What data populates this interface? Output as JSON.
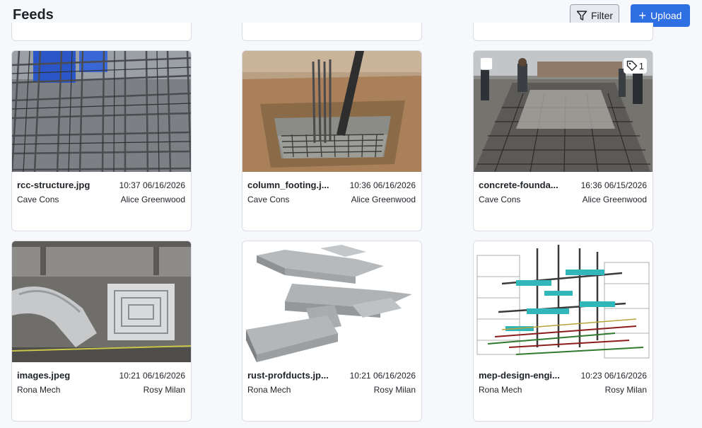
{
  "header": {
    "title": "Feeds",
    "filter_label": "Filter",
    "upload_label": "Upload"
  },
  "colors": {
    "accent": "#2f6fe4",
    "background": "#f6f8fb",
    "card_border": "#d9dde3"
  },
  "cards": [
    {
      "filename": "rcc-structure.jpg",
      "timestamp": "10:37 06/16/2026",
      "company": "Cave Cons",
      "user": "Alice Greenwood",
      "thumbnail": "rebar-cage-photo"
    },
    {
      "filename": "column_footing.j...",
      "timestamp": "10:36 06/16/2026",
      "company": "Cave Cons",
      "user": "Alice Greenwood",
      "thumbnail": "column-footing-photo"
    },
    {
      "filename": "concrete-founda...",
      "timestamp": "16:36 06/15/2026",
      "company": "Cave Cons",
      "user": "Alice Greenwood",
      "thumbnail": "concrete-pour-photo",
      "tag_count": "1"
    },
    {
      "filename": "images.jpeg",
      "timestamp": "10:21 06/16/2026",
      "company": "Rona Mech",
      "user": "Rosy Milan",
      "thumbnail": "hvac-duct-photo"
    },
    {
      "filename": "rust-profducts.jp...",
      "timestamp": "10:21 06/16/2026",
      "company": "Rona Mech",
      "user": "Rosy Milan",
      "thumbnail": "duct-render"
    },
    {
      "filename": "mep-design-engi...",
      "timestamp": "10:23 06/16/2026",
      "company": "Rona Mech",
      "user": "Rosy Milan",
      "thumbnail": "mep-model-render"
    }
  ]
}
